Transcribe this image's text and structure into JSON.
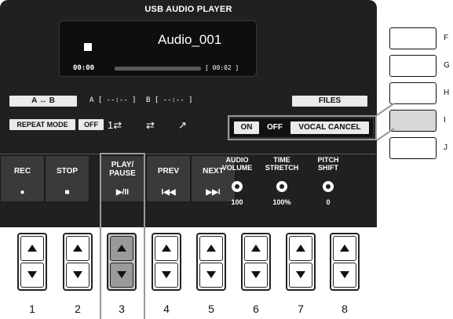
{
  "screen": {
    "title": "USB AUDIO PLAYER",
    "player": {
      "filename": "Audio_001",
      "current_time": "00:00",
      "total_time": "[ 00:02 ]",
      "progress": 0.0,
      "status_icon": "stop-icon"
    },
    "ab_repeat": {
      "button": "A ↔ B",
      "a_label": "A [ --:-- ]",
      "b_label": "B [ --:-- ]"
    },
    "files_button": "FILES",
    "repeat_mode": {
      "label": "REPEAT MODE",
      "off": "OFF",
      "icons": [
        "repeat-single-icon",
        "repeat-all-icon",
        "random-icon"
      ]
    },
    "vocal_cancel": {
      "on": "ON",
      "off": "OFF",
      "label": "VOCAL CANCEL"
    },
    "controls": [
      {
        "label": "REC",
        "symbol": "●",
        "icon": "record-icon"
      },
      {
        "label": "STOP",
        "symbol": "■",
        "icon": "stop-icon"
      },
      {
        "label": "PLAY/\nPAUSE",
        "symbol": "▶/II",
        "icon": "play-pause-icon"
      },
      {
        "label": "PREV",
        "symbol": "I◀◀",
        "icon": "prev-icon"
      },
      {
        "label": "NEXT",
        "symbol": "▶▶I",
        "icon": "next-icon"
      }
    ],
    "knobs": [
      {
        "label": "AUDIO\nVOLUME",
        "value": "100"
      },
      {
        "label": "TIME\nSTRETCH",
        "value": "100%"
      },
      {
        "label": "PITCH\nSHIFT",
        "value": "0"
      }
    ]
  },
  "side_buttons": [
    "F",
    "G",
    "H",
    "I",
    "J"
  ],
  "hardware_buttons": [
    "1",
    "2",
    "3",
    "4",
    "5",
    "6",
    "7",
    "8"
  ],
  "colors": {
    "screen_bg": "#202020",
    "highlight_bg": "#c8c8c8",
    "callout": "#999999"
  }
}
